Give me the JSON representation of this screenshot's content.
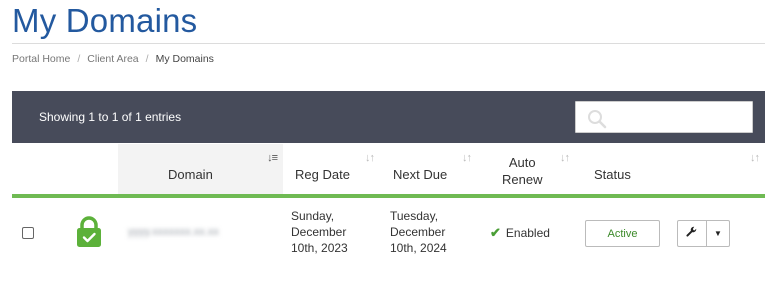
{
  "page": {
    "title": "My Domains"
  },
  "breadcrumb": {
    "items": [
      "Portal Home",
      "Client Area"
    ],
    "separator": "/",
    "current": "My Domains"
  },
  "table": {
    "info": "Showing 1 to 1 of 1 entries",
    "search": {
      "placeholder": "",
      "icon": "search-icon"
    },
    "columns": {
      "domain": "Domain",
      "reg_date": "Reg Date",
      "next_due": "Next Due",
      "auto_renew_line1": "Auto",
      "auto_renew_line2": "Renew",
      "status": "Status"
    },
    "sorted_column": "Domain",
    "rows": [
      {
        "domain": "yyyy.xxxxxxx.xx.xx",
        "lock_icon": "lock-icon",
        "reg_date_lines": [
          "Sunday,",
          "December",
          "10th, 2023"
        ],
        "next_due_lines": [
          "Tuesday,",
          "December",
          "10th, 2024"
        ],
        "auto_renew": "Enabled",
        "status": "Active",
        "actions": [
          "wrench-icon",
          "caret-down-icon"
        ]
      }
    ]
  },
  "colors": {
    "title": "#23599f",
    "toolbar_bg": "#474b5a",
    "header_underline": "#6fba53",
    "lock": "#5cb13a",
    "status_text": "#3c8a2a"
  }
}
